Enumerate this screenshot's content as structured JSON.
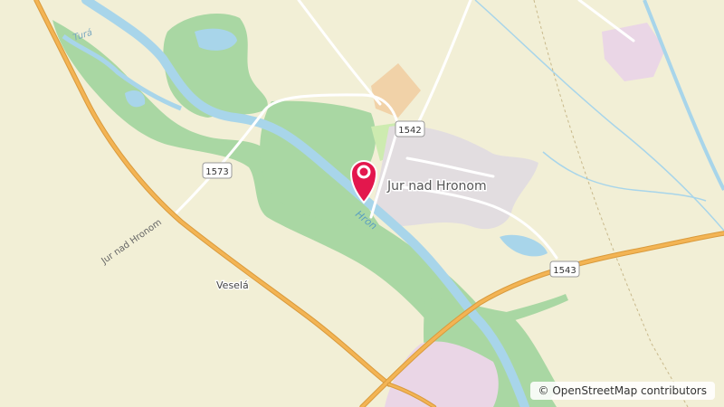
{
  "map": {
    "places": {
      "village": "Jur nad Hronom",
      "locality": "Veselá",
      "river_label": "Hron",
      "area_label": "Turá"
    },
    "roads": {
      "road_1542": "1542",
      "road_1573": "1573",
      "road_1543": "1543",
      "road_name": "Jur nad Hronom"
    },
    "marker": {
      "icon": "location-pin-icon",
      "color": "#e3174d"
    },
    "attribution": "© OpenStreetMap contributors",
    "colors": {
      "land": "#f2efd6",
      "forest": "#a9d7a3",
      "water": "#a8d5ea",
      "urban": "#e6e1e2",
      "major_road": "#f3b454",
      "minor_road": "#ffffff"
    }
  }
}
